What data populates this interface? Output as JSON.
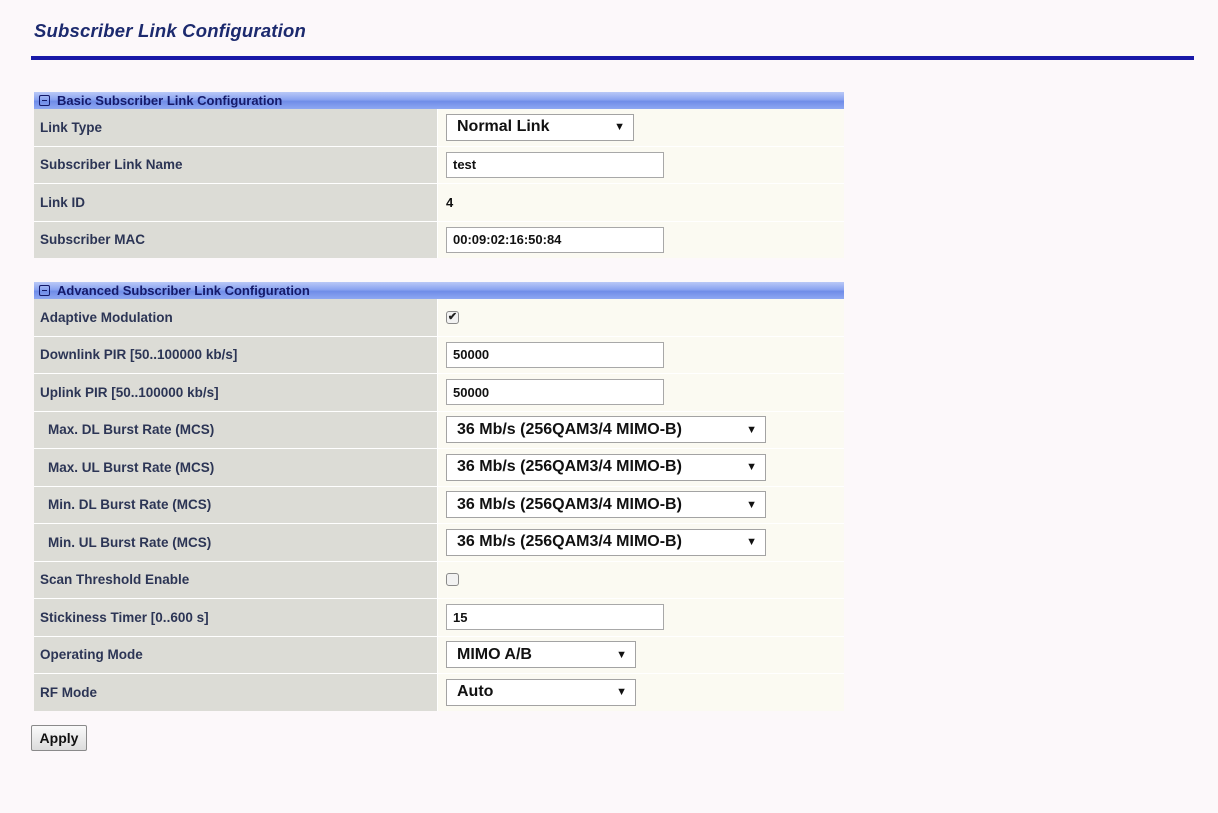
{
  "page": {
    "title": "Subscriber Link Configuration"
  },
  "basic": {
    "header": "Basic Subscriber Link Configuration",
    "link_type": {
      "label": "Link Type",
      "value": "Normal Link"
    },
    "link_name": {
      "label": "Subscriber Link Name",
      "value": "test"
    },
    "link_id": {
      "label": "Link ID",
      "value": "4"
    },
    "mac": {
      "label": "Subscriber MAC",
      "value": "00:09:02:16:50:84"
    }
  },
  "advanced": {
    "header": "Advanced Subscriber Link Configuration",
    "adaptive_modulation": {
      "label": "Adaptive Modulation",
      "checked": true
    },
    "downlink_pir": {
      "label": "Downlink PIR [50..100000 kb/s]",
      "value": "50000"
    },
    "uplink_pir": {
      "label": "Uplink PIR [50..100000 kb/s]",
      "value": "50000"
    },
    "max_dl_burst": {
      "label": "Max. DL Burst Rate (MCS)",
      "value": "36 Mb/s (256QAM3/4 MIMO-B)"
    },
    "max_ul_burst": {
      "label": "Max. UL Burst Rate (MCS)",
      "value": "36 Mb/s (256QAM3/4 MIMO-B)"
    },
    "min_dl_burst": {
      "label": "Min. DL Burst Rate (MCS)",
      "value": "36 Mb/s (256QAM3/4 MIMO-B)"
    },
    "min_ul_burst": {
      "label": "Min. UL Burst Rate (MCS)",
      "value": "36 Mb/s (256QAM3/4 MIMO-B)"
    },
    "scan_threshold": {
      "label": "Scan Threshold Enable",
      "checked": false
    },
    "stickiness_timer": {
      "label": "Stickiness Timer [0..600 s]",
      "value": "15"
    },
    "operating_mode": {
      "label": "Operating Mode",
      "value": "MIMO A/B"
    },
    "rf_mode": {
      "label": "RF Mode",
      "value": "Auto"
    }
  },
  "icons": {
    "collapse": "minus-square-icon",
    "dropdown": "caret-down-icon",
    "checkmark": "checkmark-icon"
  },
  "actions": {
    "apply_label": "Apply"
  }
}
